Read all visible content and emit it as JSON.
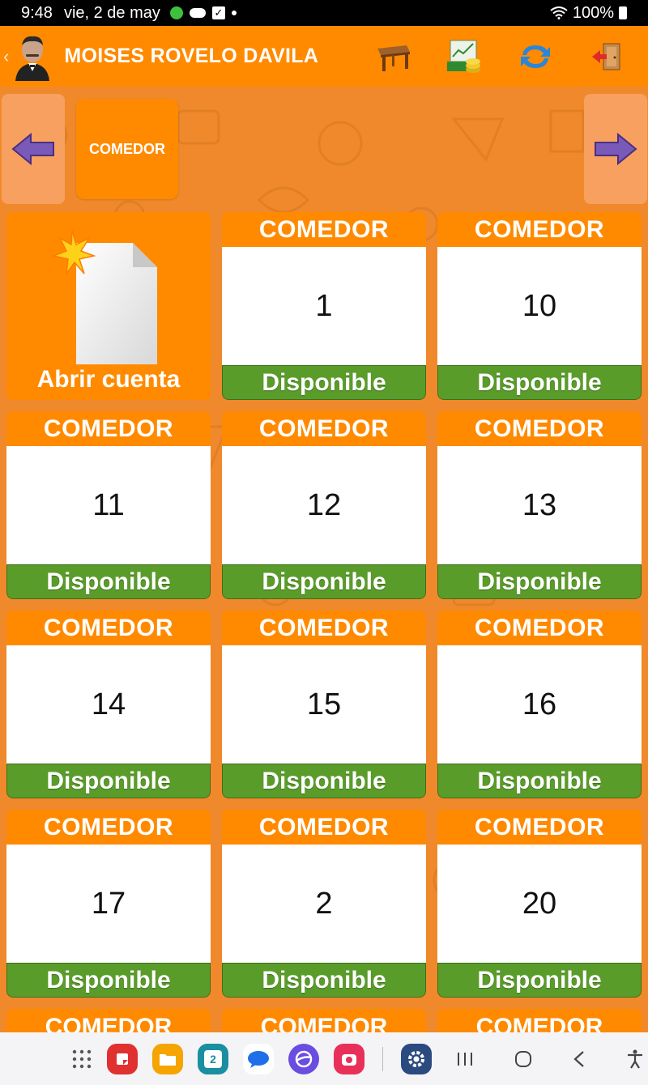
{
  "status_bar": {
    "time": "9:48",
    "date": "vie, 2 de may",
    "battery": "100%"
  },
  "header": {
    "user_name": "MOISES ROVELO DAVILA",
    "icons": [
      "table-icon",
      "cash-register-icon",
      "refresh-icon",
      "exit-door-icon"
    ]
  },
  "categories": {
    "selected": "COMEDOR"
  },
  "open_account": {
    "label": "Abrir cuenta"
  },
  "tables": [
    {
      "area": "COMEDOR",
      "number": "1",
      "status": "Disponible"
    },
    {
      "area": "COMEDOR",
      "number": "10",
      "status": "Disponible"
    },
    {
      "area": "COMEDOR",
      "number": "11",
      "status": "Disponible"
    },
    {
      "area": "COMEDOR",
      "number": "12",
      "status": "Disponible"
    },
    {
      "area": "COMEDOR",
      "number": "13",
      "status": "Disponible"
    },
    {
      "area": "COMEDOR",
      "number": "14",
      "status": "Disponible"
    },
    {
      "area": "COMEDOR",
      "number": "15",
      "status": "Disponible"
    },
    {
      "area": "COMEDOR",
      "number": "16",
      "status": "Disponible"
    },
    {
      "area": "COMEDOR",
      "number": "17",
      "status": "Disponible"
    },
    {
      "area": "COMEDOR",
      "number": "2",
      "status": "Disponible"
    },
    {
      "area": "COMEDOR",
      "number": "20",
      "status": "Disponible"
    }
  ],
  "partial_row": [
    "COMEDOR",
    "COMEDOR",
    "COMEDOR"
  ],
  "colors": {
    "accent": "#ff8a00",
    "available": "#5a9c2a",
    "background": "#f0892b"
  },
  "dock": {
    "calendar_day": "2"
  }
}
